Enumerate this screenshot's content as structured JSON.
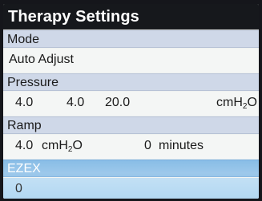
{
  "screen": {
    "title": "Therapy Settings"
  },
  "settings": {
    "mode": {
      "label": "Mode",
      "value": "Auto Adjust"
    },
    "pressure": {
      "label": "Pressure",
      "min": "4.0",
      "ramp_start": "4.0",
      "max": "20.0",
      "unit_prefix": "cmH",
      "unit_sub": "2",
      "unit_suffix": "O"
    },
    "ramp": {
      "label": "Ramp",
      "pressure": "4.0",
      "unit_prefix": "cmH",
      "unit_sub": "2",
      "unit_suffix": "O",
      "time": "0",
      "time_unit": "minutes"
    },
    "ezex": {
      "label": "EZEX",
      "value": "0",
      "selected": true
    }
  },
  "colors": {
    "title_bar": "#16181c",
    "header_row": "#cfd8e8",
    "selected_header": "#7cb6e4",
    "selected_value": "#b3d8f2"
  }
}
